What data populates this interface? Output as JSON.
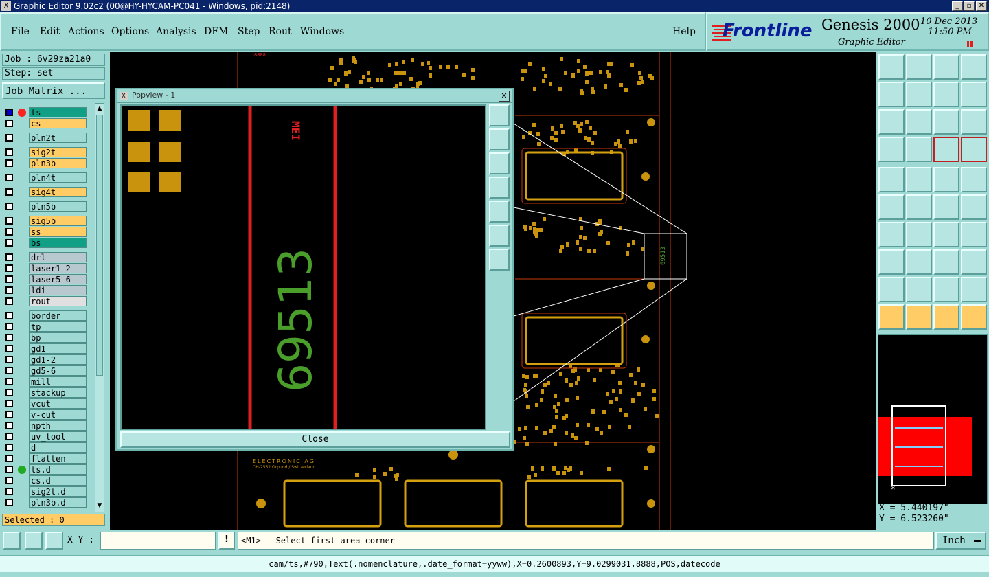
{
  "window": {
    "title": "Graphic Editor 9.02c2 (00@HY-HYCAM-PC041 - Windows, pid:2148)",
    "min_label": "_",
    "max_label": "▫",
    "close_label": "✕"
  },
  "menu": {
    "file": "File",
    "edit": "Edit",
    "actions": "Actions",
    "options": "Options",
    "analysis": "Analysis",
    "dfm": "DFM",
    "step": "Step",
    "rout": "Rout",
    "windows": "Windows",
    "help": "Help"
  },
  "brand": {
    "logo": "Frontline",
    "product": "Genesis 2000",
    "subtitle": "Graphic Editor",
    "date": "10 Dec 2013",
    "time": "11:50 PM"
  },
  "job": {
    "job_label": "Job : 6v29za21a0",
    "step_label": "Step: set",
    "matrix_button": "Job Matrix ..."
  },
  "layers": [
    {
      "name": "ts",
      "color": "#11a085",
      "active": true
    },
    {
      "name": "cs",
      "color": "#ffcc66"
    },
    {
      "name": "pln2t",
      "color": "#9ed9d4"
    },
    {
      "name": "sig2t",
      "color": "#ffcc66"
    },
    {
      "name": "pln3b",
      "color": "#ffcc66"
    },
    {
      "name": "pln4t",
      "color": "#9ed9d4"
    },
    {
      "name": "sig4t",
      "color": "#ffcc66"
    },
    {
      "name": "pln5b",
      "color": "#9ed9d4"
    },
    {
      "name": "sig5b",
      "color": "#ffcc66"
    },
    {
      "name": "ss",
      "color": "#ffcc66"
    },
    {
      "name": "bs",
      "color": "#11a085"
    },
    {
      "name": "drl",
      "color": "#b8c8cf"
    },
    {
      "name": "laser1-2",
      "color": "#b8c8cf"
    },
    {
      "name": "laser5-6",
      "color": "#b8c8cf"
    },
    {
      "name": "ldi",
      "color": "#b8c8cf"
    },
    {
      "name": "rout",
      "color": "#e0e0e0"
    },
    {
      "name": "border",
      "color": "#9ed9d4"
    },
    {
      "name": "tp",
      "color": "#9ed9d4"
    },
    {
      "name": "bp",
      "color": "#9ed9d4"
    },
    {
      "name": "gd1",
      "color": "#9ed9d4"
    },
    {
      "name": "gd1-2",
      "color": "#9ed9d4"
    },
    {
      "name": "gd5-6",
      "color": "#9ed9d4"
    },
    {
      "name": "mill",
      "color": "#9ed9d4"
    },
    {
      "name": "stackup",
      "color": "#9ed9d4"
    },
    {
      "name": "vcut",
      "color": "#9ed9d4"
    },
    {
      "name": "v-cut",
      "color": "#9ed9d4"
    },
    {
      "name": "npth",
      "color": "#9ed9d4"
    },
    {
      "name": "uv_tool",
      "color": "#9ed9d4"
    },
    {
      "name": "d",
      "color": "#9ed9d4"
    },
    {
      "name": "flatten",
      "color": "#9ed9d4"
    },
    {
      "name": "ts.d",
      "color": "#9ed9d4"
    },
    {
      "name": "cs.d",
      "color": "#9ed9d4"
    },
    {
      "name": "sig2t.d",
      "color": "#9ed9d4"
    },
    {
      "name": "pln3b.d",
      "color": "#9ed9d4"
    }
  ],
  "selected": "Selected : 0",
  "popview": {
    "title": "Popview - 1",
    "close_button": "Close",
    "big_text": "69513",
    "small_text": "MEI"
  },
  "coords": {
    "x": "X = 5.440197\"",
    "y": "Y = 6.523260\""
  },
  "status": {
    "xy_label": "X Y :",
    "xy_value": "",
    "prompt": "<M1> - Select first area corner",
    "units": "Inch"
  },
  "info": "cam/ts,#790,Text(.nomenclature,.date_format=yyww),X=0.2600893,Y=9.0299031,8888,POS,datecode",
  "canvas_text": {
    "board_label": "69513",
    "logo_line1": "ELECTRONIC AG",
    "logo_line2": "CH-2552 Orpund / Switzerland",
    "marker": "8888"
  },
  "colors": {
    "accent": "#9ed9d4",
    "pad": "#c9930e",
    "trace_red": "#e02020",
    "silk_green": "#4a9e2a"
  }
}
